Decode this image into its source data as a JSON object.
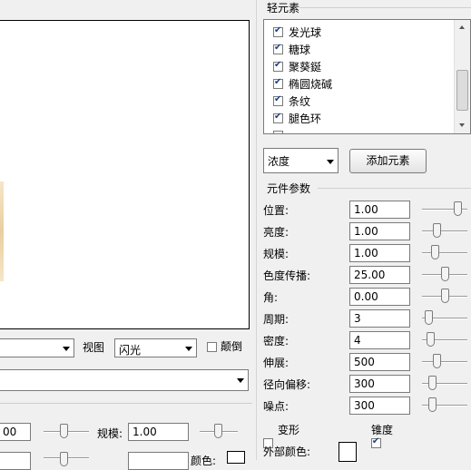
{
  "right_panel": {
    "elements_group_title": "轻元素",
    "element_items": [
      {
        "label": "发光球",
        "checked": true
      },
      {
        "label": "糖球",
        "checked": true
      },
      {
        "label": "聚葵鋋",
        "checked": true
      },
      {
        "label": "椭圆烧碱",
        "checked": true
      },
      {
        "label": "条纹",
        "checked": true
      },
      {
        "label": "腿色环",
        "checked": true
      }
    ],
    "element_type_value": "浓度",
    "add_element_button": "添加元素",
    "params_group_title": "元件参数",
    "params": [
      {
        "label": "位置:",
        "value": "1.00",
        "level": 0.85
      },
      {
        "label": "亮度:",
        "value": "1.00",
        "level": 0.3
      },
      {
        "label": "规模:",
        "value": "1.00",
        "level": 0.25
      },
      {
        "label": "色度传播:",
        "value": "25.00",
        "level": 0.5
      },
      {
        "label": "角:",
        "value": "0.00",
        "level": 0.5
      },
      {
        "label": "周期:",
        "value": "3",
        "level": 0.08
      },
      {
        "label": "密度:",
        "value": "4",
        "level": 0.12
      },
      {
        "label": "伸展:",
        "value": "500",
        "level": 0.3
      },
      {
        "label": "径向偏移:",
        "value": "300",
        "level": 0.18
      },
      {
        "label": "噪点:",
        "value": "300",
        "level": 0.18
      }
    ],
    "deform_label": "变形",
    "deform_checked": false,
    "taper_label": "锥度",
    "taper_checked": true,
    "outer_color_label": "外部颜色:"
  },
  "left_panel": {
    "view_label": "视图",
    "view_value": "闪光",
    "flip_label": "颠倒",
    "flip_checked": false,
    "bottom_value_left": "00",
    "scale_label": "规模:",
    "scale_value": "1.00",
    "color_label": "颜色:"
  }
}
